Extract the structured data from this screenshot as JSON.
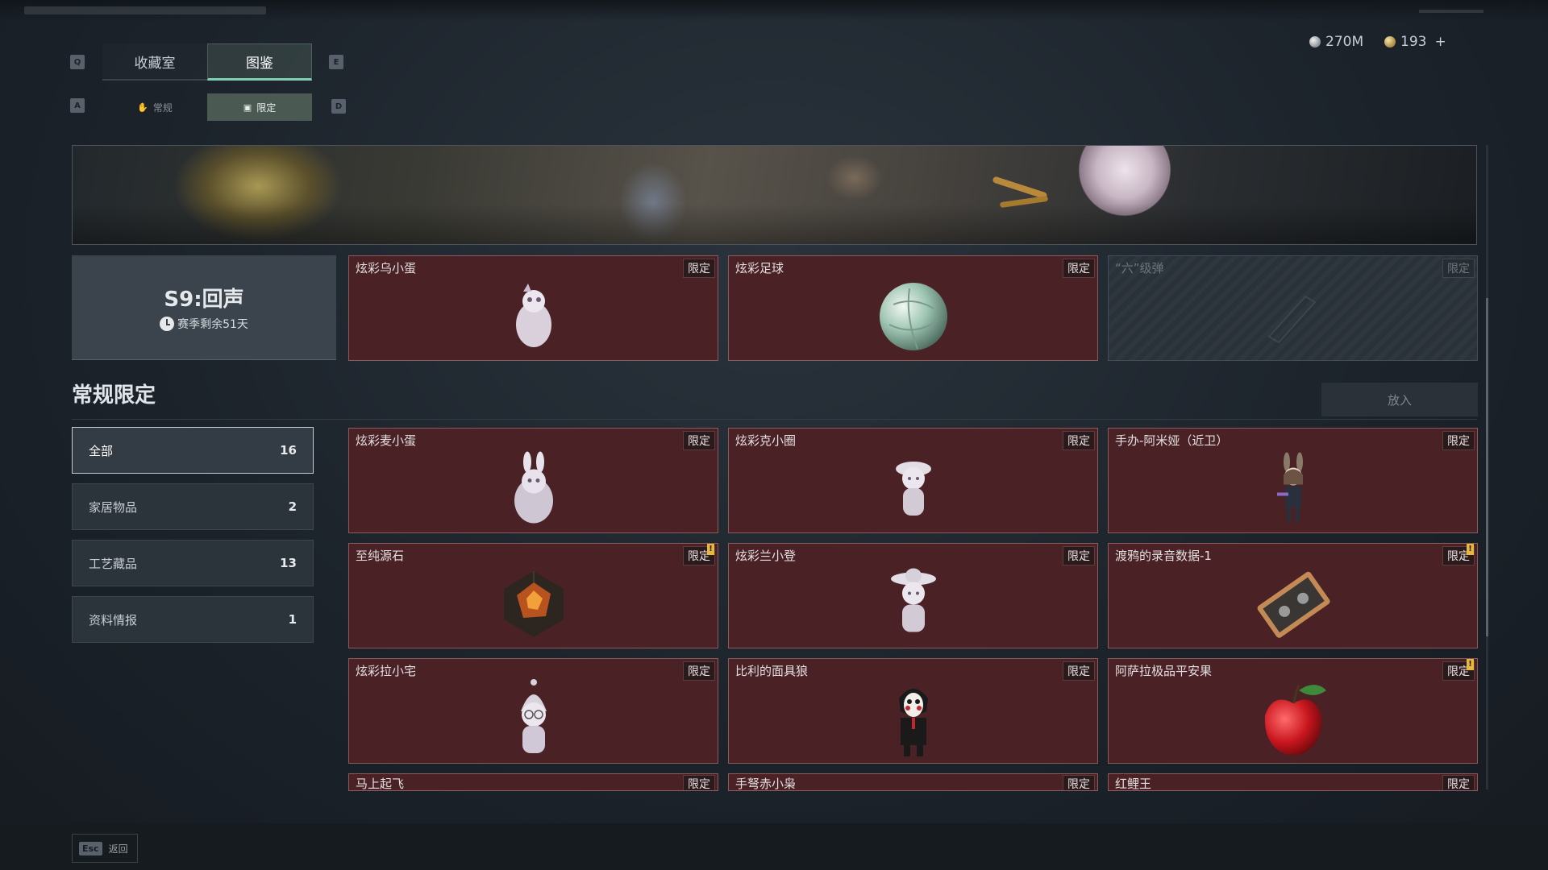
{
  "header": {
    "key_left": "Q",
    "key_right": "E",
    "tabs": [
      {
        "label": "收藏室",
        "active": false
      },
      {
        "label": "图鉴",
        "active": true
      }
    ],
    "sub_key_left": "A",
    "sub_key_right": "D",
    "sub_tabs": [
      {
        "label": "常规",
        "active": false
      },
      {
        "label": "限定",
        "active": true
      }
    ]
  },
  "currency": {
    "silver": "270M",
    "gold": "193",
    "add": "+"
  },
  "season": {
    "title": "S9:回声",
    "remaining": "赛季剩余51天"
  },
  "featured": [
    {
      "name": "炫彩乌小蛋",
      "tag": "限定",
      "icon": "egg-figure-icon"
    },
    {
      "name": "炫彩足球",
      "tag": "限定",
      "icon": "football-icon"
    },
    {
      "name": "“六”级弹",
      "tag": "限定",
      "icon": "bullet-icon",
      "locked": true
    }
  ],
  "section": {
    "title": "常规限定",
    "put_button": "放入"
  },
  "categories": [
    {
      "label": "全部",
      "count": "16",
      "active": true
    },
    {
      "label": "家居物品",
      "count": "2"
    },
    {
      "label": "工艺藏品",
      "count": "13"
    },
    {
      "label": "资料情报",
      "count": "1"
    }
  ],
  "items": [
    {
      "name": "炫彩麦小蛋",
      "tag": "限定",
      "icon": "bunny-egg-icon"
    },
    {
      "name": "炫彩克小圈",
      "tag": "限定",
      "icon": "hat-figure-icon"
    },
    {
      "name": "手办-阿米娅（近卫）",
      "tag": "限定",
      "icon": "anime-figure-icon"
    },
    {
      "name": "至纯源石",
      "tag": "限定",
      "icon": "crystal-icon",
      "alert": "!"
    },
    {
      "name": "炫彩兰小登",
      "tag": "限定",
      "icon": "sombrero-figure-icon"
    },
    {
      "name": "渡鸦的录音数据-1",
      "tag": "限定",
      "icon": "cassette-icon",
      "alert": "!"
    },
    {
      "name": "炫彩拉小宅",
      "tag": "限定",
      "icon": "hood-figure-icon"
    },
    {
      "name": "比利的面具狼",
      "tag": "限定",
      "icon": "puppet-icon"
    },
    {
      "name": "阿萨拉极品平安果",
      "tag": "限定",
      "icon": "apple-icon",
      "alert": "!"
    },
    {
      "name": "马上起飞",
      "tag": "限定"
    },
    {
      "name": "手弩赤小枭",
      "tag": "限定"
    },
    {
      "name": "红鲤王",
      "tag": "限定"
    }
  ],
  "footer": {
    "esc_key": "Esc",
    "esc_label": "返回"
  },
  "colors": {
    "card_bg": "#4a2226",
    "card_border": "#8b5a5d",
    "accent": "#7fd0b0"
  }
}
